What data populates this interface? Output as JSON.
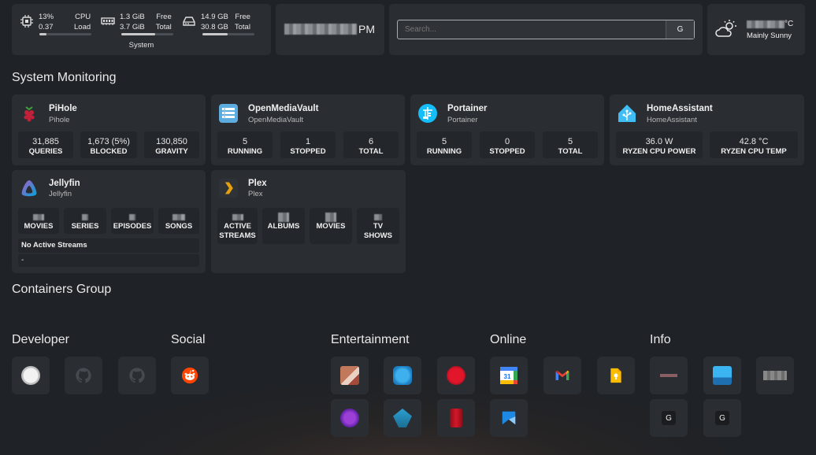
{
  "widgets": {
    "cpu": {
      "percent": "13%",
      "load": "0.37",
      "label1": "CPU",
      "label2": "Load",
      "fill": 0.13
    },
    "memory": {
      "used": "1.3 GiB",
      "total": "3.7 GiB",
      "label1": "Free",
      "label2": "Total",
      "fill": 0.65
    },
    "disk": {
      "used": "14.9 GB",
      "total": "30.8 GB",
      "label1": "Free",
      "label2": "Total",
      "fill": 0.48
    },
    "system_label": "System",
    "clock_suffix": "PM",
    "search": {
      "placeholder": "Search...",
      "button": "G"
    },
    "weather": {
      "temp_unit": "°C",
      "condition": "Mainly Sunny"
    }
  },
  "sections": {
    "monitoring": "System Monitoring",
    "containers": "Containers Group"
  },
  "services": [
    {
      "title": "PiHole",
      "subtitle": "Pihole",
      "stats": [
        {
          "v": "31,885",
          "l": "QUERIES"
        },
        {
          "v": "1,673 (5%)",
          "l": "BLOCKED"
        },
        {
          "v": "130,850",
          "l": "GRAVITY"
        }
      ]
    },
    {
      "title": "OpenMediaVault",
      "subtitle": "OpenMediaVault",
      "stats": [
        {
          "v": "5",
          "l": "RUNNING"
        },
        {
          "v": "1",
          "l": "STOPPED"
        },
        {
          "v": "6",
          "l": "TOTAL"
        }
      ]
    },
    {
      "title": "Portainer",
      "subtitle": "Portainer",
      "stats": [
        {
          "v": "5",
          "l": "RUNNING"
        },
        {
          "v": "0",
          "l": "STOPPED"
        },
        {
          "v": "5",
          "l": "TOTAL"
        }
      ]
    },
    {
      "title": "HomeAssistant",
      "subtitle": "HomeAssistant",
      "stats": [
        {
          "v": "36.0 W",
          "l": "RYZEN CPU POWER"
        },
        {
          "v": "42.8 °C",
          "l": "RYZEN CPU TEMP"
        }
      ]
    },
    {
      "title": "Jellyfin",
      "subtitle": "Jellyfin",
      "stats": [
        {
          "l": "MOVIES"
        },
        {
          "l": "SERIES"
        },
        {
          "l": "EPISODES"
        },
        {
          "l": "SONGS"
        }
      ],
      "streams": "No Active Streams",
      "dash": "-"
    },
    {
      "title": "Plex",
      "subtitle": "Plex",
      "stats": [
        {
          "l": "ACTIVE STREAMS"
        },
        {
          "l": "ALBUMS"
        },
        {
          "l": "MOVIES"
        },
        {
          "l": "TV SHOWS"
        }
      ]
    }
  ],
  "groups": [
    {
      "name": "Developer"
    },
    {
      "name": "Social"
    },
    {
      "name": "Entertainment"
    },
    {
      "name": "Online"
    },
    {
      "name": "Info"
    }
  ],
  "bookmark_letters": {
    "g1": "G",
    "g2": "G"
  },
  "colors": {
    "card": "#2a2e33",
    "inner": "#23272b",
    "background": "#1f2226",
    "bar_fill": "#c9c9c9"
  }
}
